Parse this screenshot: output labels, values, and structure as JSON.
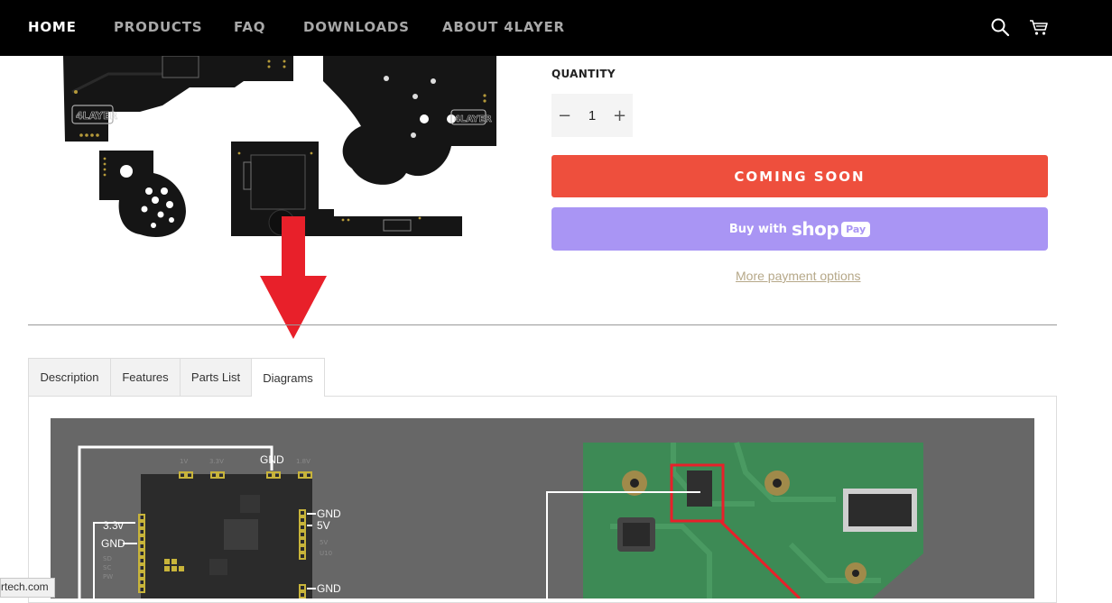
{
  "nav": {
    "items": [
      {
        "label": "HOME",
        "active": true
      },
      {
        "label": "PRODUCTS",
        "active": false
      },
      {
        "label": "FAQ",
        "active": false
      },
      {
        "label": "DOWNLOADS",
        "active": false
      },
      {
        "label": "ABOUT 4LAYER",
        "active": false
      }
    ],
    "icons": [
      "search-icon",
      "cart-icon"
    ]
  },
  "product": {
    "quantity_label": "QUANTITY",
    "quantity_value": "1",
    "minus_label": "−",
    "plus_label": "+",
    "coming_soon_label": "COMING SOON",
    "shop_pay": {
      "buy_label": "Buy with",
      "shop_label": "shop",
      "pay_label": "Pay"
    },
    "more_payment_label": "More payment options",
    "logo_text": "4LAYER"
  },
  "tabs": [
    {
      "label": "Description",
      "active": false
    },
    {
      "label": "Features",
      "active": false
    },
    {
      "label": "Parts List",
      "active": false
    },
    {
      "label": "Diagrams",
      "active": true
    }
  ],
  "diagram": {
    "labels": {
      "gnd_top": "GND",
      "v33": "3.3v",
      "gnd_left": "GND",
      "gnd_right1": "GND",
      "v5": "5V",
      "gnd_right2": "GND"
    }
  },
  "status_bar": {
    "url": "rtech.com"
  },
  "colors": {
    "accent": "#ee4f3d",
    "shop_pay": "#a995f4",
    "nav_bg": "#000000",
    "link": "#b6a889",
    "arrow": "#e8202a"
  }
}
